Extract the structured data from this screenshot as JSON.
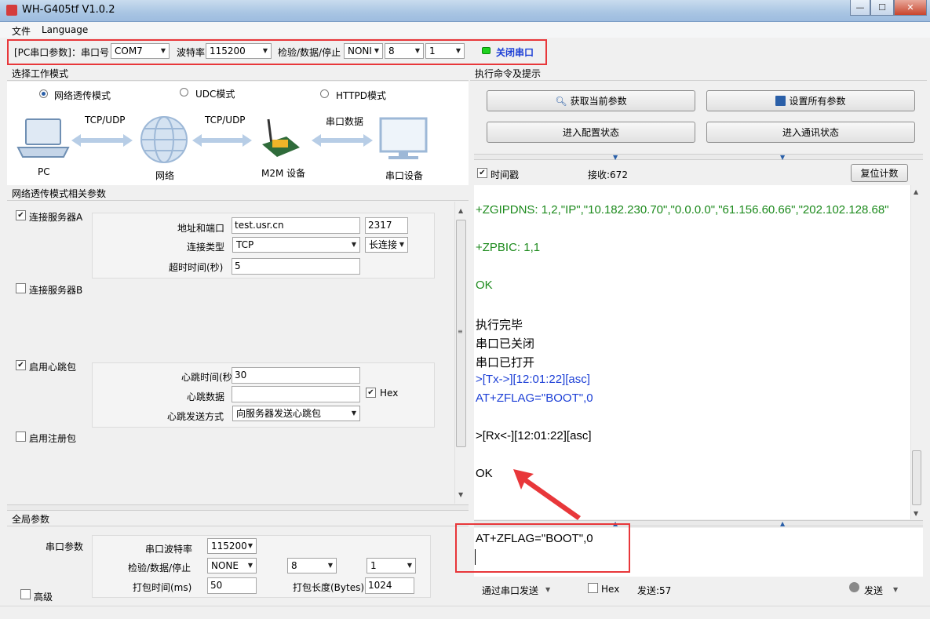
{
  "window": {
    "title": "WH-G405tf V1.0.2"
  },
  "menu": {
    "file": "文件",
    "language": "Language"
  },
  "serial": {
    "label": "[PC串口参数]：串口号",
    "port": "COM7",
    "baud_label": "波特率",
    "baud": "115200",
    "check_label": "检验/数据/停止",
    "parity": "NONI",
    "databits": "8",
    "stopbits": "1",
    "toggle_label": "关闭串口",
    "led_color": "#1fd11f"
  },
  "mode": {
    "header": "选择工作模式",
    "options": [
      "网络透传模式",
      "UDC模式",
      "HTTPD模式"
    ],
    "selected": "网络透传模式",
    "diagram": {
      "pc": "PC",
      "link1": "TCP/UDP",
      "network": "网络",
      "link2": "TCP/UDP",
      "device": "M2M 设备",
      "link3": "串口数据",
      "serial_device": "串口设备"
    }
  },
  "params": {
    "header": "网络透传模式相关参数",
    "serverA": {
      "label": "连接服务器A",
      "checked": true,
      "addr_label": "地址和端口",
      "addr": "test.usr.cn",
      "port": "2317",
      "type_label": "连接类型",
      "type": "TCP",
      "conn_mode": "长连接",
      "timeout_label": "超时时间(秒)",
      "timeout": "5"
    },
    "serverB": {
      "label": "连接服务器B",
      "checked": false
    },
    "heartbeat": {
      "label": "启用心跳包",
      "checked": true,
      "time_label": "心跳时间(秒)",
      "time": "30",
      "data_label": "心跳数据",
      "data": "",
      "hex_label": "Hex",
      "hex_checked": true,
      "method_label": "心跳发送方式",
      "method": "向服务器发送心跳包"
    },
    "register": {
      "label": "启用注册包",
      "checked": false
    }
  },
  "global": {
    "header": "全局参数",
    "serial_params_label": "串口参数",
    "baud_label": "串口波特率",
    "baud": "115200",
    "check_label": "检验/数据/停止",
    "parity": "NONE",
    "databits": "8",
    "stopbits": "1",
    "pack_time_label": "打包时间(ms)",
    "pack_time": "50",
    "pack_len_label": "打包长度(Bytes)",
    "pack_len": "1024",
    "advanced_label": "高级"
  },
  "exec": {
    "header": "执行命令及提示",
    "get_params": "获取当前参数",
    "set_params": "设置所有参数",
    "enter_config": "进入配置状态",
    "enter_comm": "进入通讯状态",
    "timestamp_label": "时间戳",
    "timestamp_checked": true,
    "recv_label": "接收:672",
    "reset_count": "复位计数"
  },
  "terminal": {
    "lines": [
      {
        "text": "+ZGIPDNS: 1,2,\"IP\",\"10.182.230.70\",\"0.0.0.0\",\"61.156.60.66\",\"202.102.128.68\"",
        "color": "green"
      },
      {
        "text": "+ZPBIC: 1,1",
        "color": "green"
      },
      {
        "text": "OK",
        "color": "green"
      },
      {
        "text": "执行完毕",
        "color": "black"
      },
      {
        "text": "串口已关闭",
        "color": "black"
      },
      {
        "text": "串口已打开",
        "color": "black"
      },
      {
        "text": ">[Tx->][12:01:22][asc]",
        "color": "blue"
      },
      {
        "text": "AT+ZFLAG=\"BOOT\",0",
        "color": "blue"
      },
      {
        "text": ">[Rx<-][12:01:22][asc]",
        "color": "black"
      },
      {
        "text": "OK",
        "color": "black"
      }
    ]
  },
  "send": {
    "input": "AT+ZFLAG=\"BOOT\",0",
    "mode": "通过串口发送",
    "hex_label": "Hex",
    "sent_label": "发送:57",
    "send_button": "发送"
  }
}
